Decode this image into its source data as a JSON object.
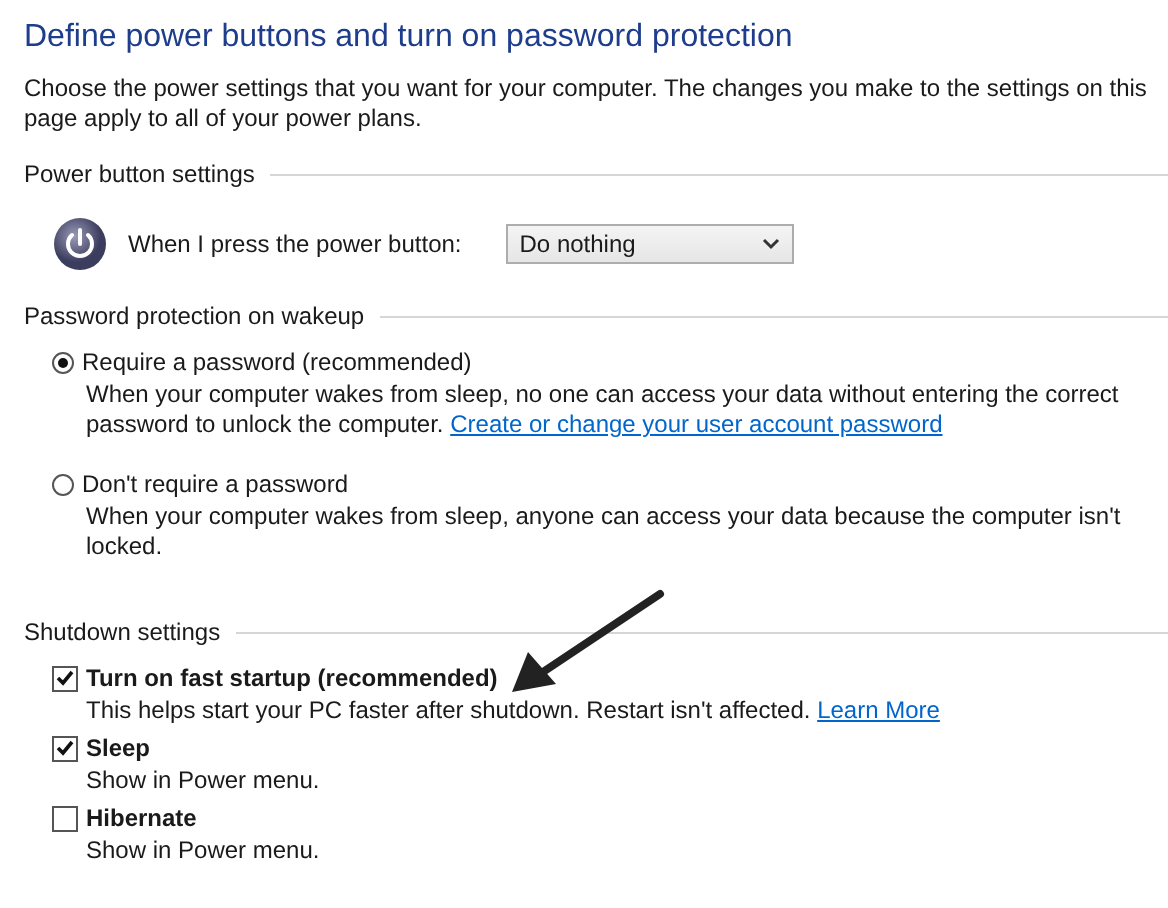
{
  "title": "Define power buttons and turn on password protection",
  "intro": "Choose the power settings that you want for your computer. The changes you make to the settings on this page apply to all of your power plans.",
  "power_button_settings": {
    "heading": "Power button settings",
    "label": "When I press the power button:",
    "dropdown": {
      "value": "Do nothing"
    }
  },
  "password_protection": {
    "heading": "Password protection on wakeup",
    "options": [
      {
        "label": "Require a password (recommended)",
        "selected": true,
        "description": "When your computer wakes from sleep, no one can access your data without entering the correct password to unlock the computer.",
        "link": "Create or change your user account password"
      },
      {
        "label": "Don't require a password",
        "selected": false,
        "description": "When your computer wakes from sleep, anyone can access your data because the computer isn't locked."
      }
    ]
  },
  "shutdown_settings": {
    "heading": "Shutdown settings",
    "options": [
      {
        "label": "Turn on fast startup (recommended)",
        "checked": true,
        "description": "This helps start your PC faster after shutdown. Restart isn't affected.",
        "link": "Learn More"
      },
      {
        "label": "Sleep",
        "checked": true,
        "description": "Show in Power menu."
      },
      {
        "label": "Hibernate",
        "checked": false,
        "description": "Show in Power menu."
      }
    ]
  }
}
